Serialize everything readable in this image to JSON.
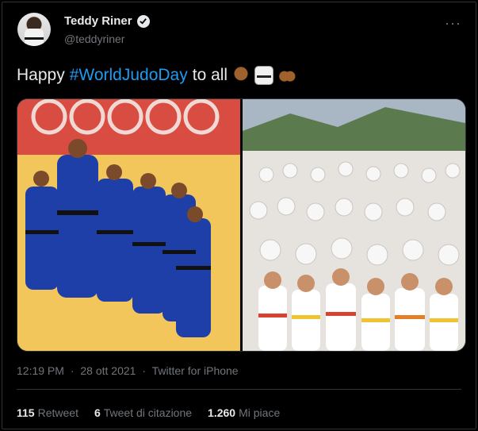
{
  "author": {
    "name": "Teddy Riner",
    "handle": "@teddyriner",
    "verified": true
  },
  "tweet": {
    "text_before": "Happy ",
    "hashtag": "#WorldJudoDay",
    "text_after": " to all",
    "emojis": [
      "folded-hands",
      "martial-arts-uniform",
      "raising-hands"
    ]
  },
  "meta": {
    "time": "12:19 PM",
    "date": "28 ott 2021",
    "source": "Twitter for iPhone",
    "separator": "·"
  },
  "stats": {
    "retweets_count": "115",
    "retweets_label": "Retweet",
    "quotes_count": "6",
    "quotes_label": "Tweet di citazione",
    "likes_count": "1.260",
    "likes_label": "Mi piace"
  },
  "colors": {
    "background": "#000000",
    "text": "#e7e9ea",
    "secondary": "#71767b",
    "link": "#1d9bf0",
    "divider": "#2f3336",
    "judogi_blue": "#1f3fa8"
  }
}
